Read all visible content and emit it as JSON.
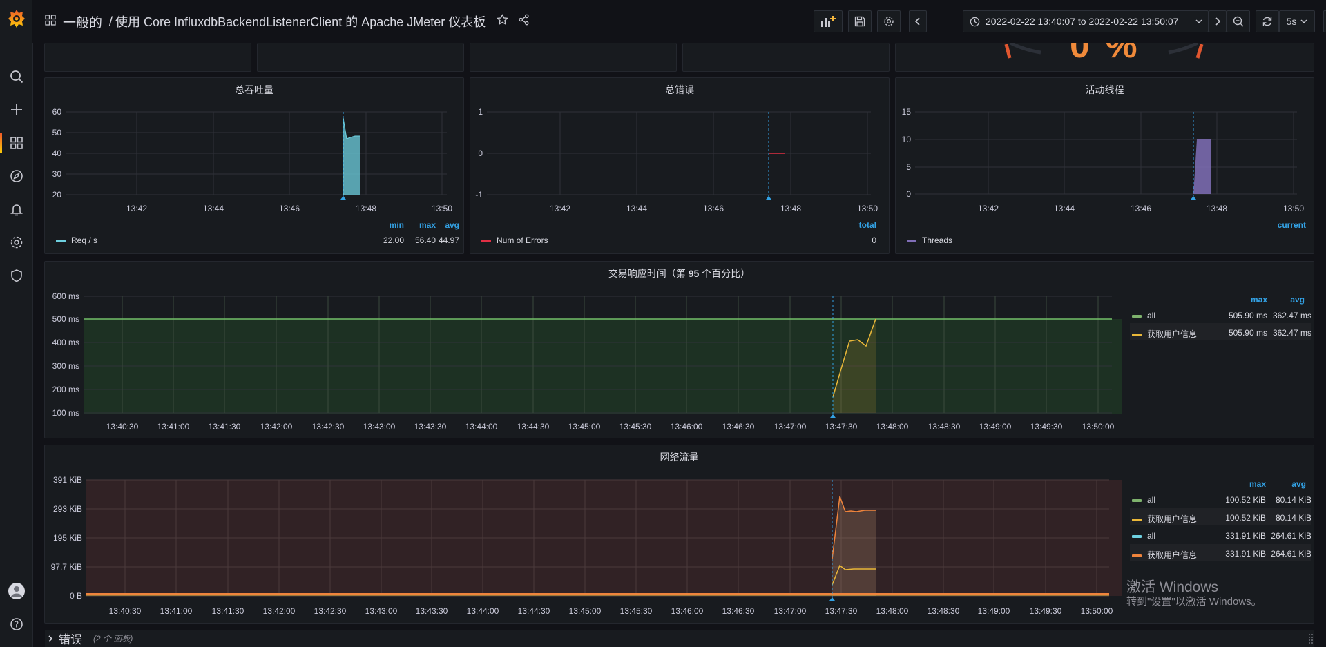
{
  "breadcrumb": {
    "folder": "一般的",
    "separator": "/",
    "title": "使用 Core InfluxdbBackendListenerClient 的 Apache JMeter 仪表板"
  },
  "timepicker": {
    "range": "2022-02-22 13:40:07 to 2022-02-22 13:50:07"
  },
  "refresh": {
    "interval": "5s"
  },
  "icons": {
    "logo": "grafana-logo-icon",
    "sidebar": [
      "search-icon",
      "plus-icon",
      "dashboards-icon",
      "explore-icon",
      "alerting-icon",
      "settings-icon",
      "shield-icon",
      "avatar",
      "help-icon"
    ]
  },
  "gauge_fragment": {
    "text": "0 %"
  },
  "panels": {
    "throughput": {
      "title": "总吞吐量",
      "legend_header": [
        "min",
        "max",
        "avg"
      ],
      "legend": [
        {
          "name": "Req / s",
          "color": "#6ed0e0",
          "values": [
            "22.00",
            "56.40",
            "44.97"
          ]
        }
      ],
      "y_ticks": [
        "60",
        "50",
        "40",
        "30",
        "20"
      ],
      "x_ticks": [
        "13:42",
        "13:44",
        "13:46",
        "13:48",
        "13:50"
      ]
    },
    "errors": {
      "title": "总错误",
      "legend_header": [
        "total"
      ],
      "legend": [
        {
          "name": "Num of Errors",
          "color": "#e02f44",
          "values": [
            "0"
          ]
        }
      ],
      "y_ticks": [
        "1",
        "0",
        "-1"
      ],
      "x_ticks": [
        "13:42",
        "13:44",
        "13:46",
        "13:48",
        "13:50"
      ]
    },
    "threads": {
      "title": "活动线程",
      "legend_header": [
        "current"
      ],
      "legend": [
        {
          "name": "Threads",
          "color": "#806eb7",
          "values": [
            ""
          ]
        }
      ],
      "y_ticks": [
        "15",
        "10",
        "5",
        "0"
      ],
      "x_ticks": [
        "13:42",
        "13:44",
        "13:46",
        "13:48",
        "13:50"
      ]
    },
    "response": {
      "title_prefix": "交易响应时间（第 ",
      "title_num": "95",
      "title_suffix": " 个百分比）",
      "legend_header": [
        "max",
        "avg"
      ],
      "legend": [
        {
          "name": "all",
          "color": "#7eb26d",
          "values": [
            "505.90 ms",
            "362.47 ms"
          ]
        },
        {
          "name": "获取用户信息",
          "color": "#eab839",
          "values": [
            "505.90 ms",
            "362.47 ms"
          ]
        }
      ],
      "y_ticks": [
        "600 ms",
        "500 ms",
        "400 ms",
        "300 ms",
        "200 ms",
        "100 ms"
      ],
      "x_ticks": [
        "13:40:30",
        "13:41:00",
        "13:41:30",
        "13:42:00",
        "13:42:30",
        "13:43:00",
        "13:43:30",
        "13:44:00",
        "13:44:30",
        "13:45:00",
        "13:45:30",
        "13:46:00",
        "13:46:30",
        "13:47:00",
        "13:47:30",
        "13:48:00",
        "13:48:30",
        "13:49:00",
        "13:49:30",
        "13:50:00"
      ]
    },
    "network": {
      "title": "网络流量",
      "legend_header": [
        "max",
        "avg"
      ],
      "legend": [
        {
          "name": "all",
          "color": "#7eb26d",
          "values": [
            "100.52 KiB",
            "80.14 KiB"
          ]
        },
        {
          "name": "获取用户信息",
          "color": "#eab839",
          "values": [
            "100.52 KiB",
            "80.14 KiB"
          ]
        },
        {
          "name": "all",
          "color": "#6ed0e0",
          "values": [
            "331.91 KiB",
            "264.61 KiB"
          ]
        },
        {
          "name": "获取用户信息",
          "color": "#ef843c",
          "values": [
            "331.91 KiB",
            "264.61 KiB"
          ]
        }
      ],
      "y_ticks": [
        "391 KiB",
        "293 KiB",
        "195 KiB",
        "97.7 KiB",
        "0 B"
      ],
      "x_ticks": [
        "13:40:30",
        "13:41:00",
        "13:41:30",
        "13:42:00",
        "13:42:30",
        "13:43:00",
        "13:43:30",
        "13:44:00",
        "13:44:30",
        "13:45:00",
        "13:45:30",
        "13:46:00",
        "13:46:30",
        "13:47:00",
        "13:47:30",
        "13:48:00",
        "13:48:30",
        "13:49:00",
        "13:49:30",
        "13:50:00"
      ]
    }
  },
  "collapsed_row": {
    "title": "错误",
    "count": "(2 个 面板)"
  },
  "watermark": {
    "line1": "激活 Windows",
    "line2": "转到\"设置\"以激活 Windows。"
  }
}
